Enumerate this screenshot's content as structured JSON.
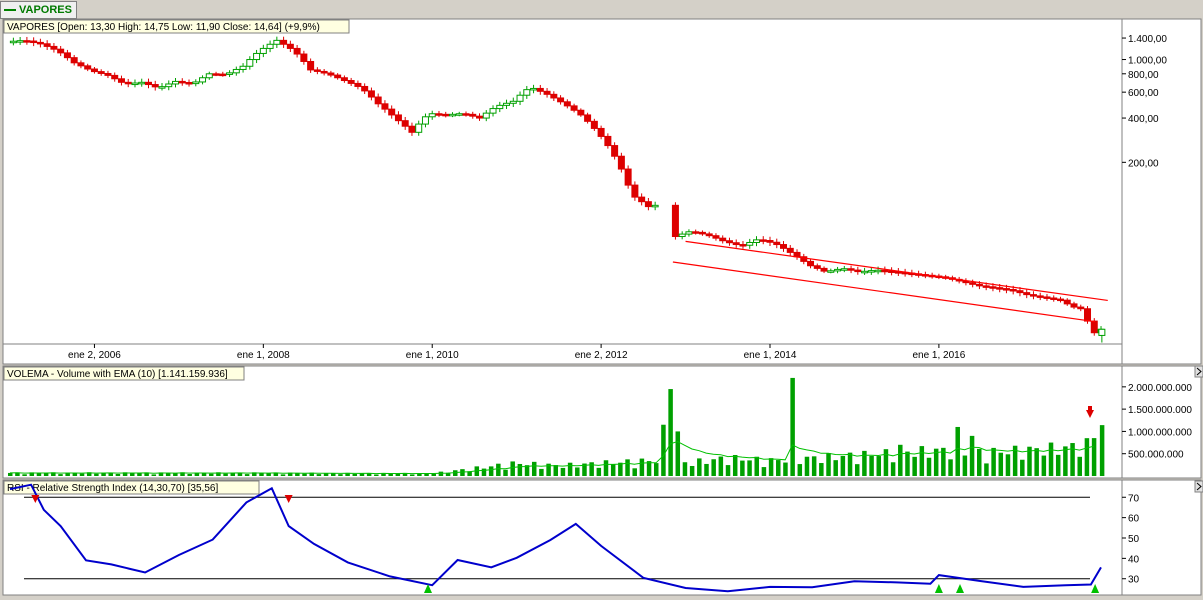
{
  "tab_label": "VAPORES",
  "panels": {
    "price": {
      "caption": "VAPORES [Open: 13,30  High: 14,75  Low: 11,90  Close: 14,64] (+9,9%)"
    },
    "volume": {
      "caption": "VOLEMA - Volume with EMA (10) [1.141.159.936]"
    },
    "rsi": {
      "caption": "RSI - Relative Strength Index (14,30,70) [35,56]"
    }
  },
  "x_axis": {
    "tick_labels": [
      "ene 2, 2006",
      "ene 1, 2008",
      "ene 1, 2010",
      "ene 2, 2012",
      "ene 1, 2014",
      "ene 1, 2016"
    ],
    "tick_years": [
      2006,
      2008,
      2010,
      2012,
      2014,
      2016
    ]
  },
  "colors": {
    "up": "#00a000",
    "down": "#dd0000",
    "ema": "#00c000",
    "rsi_line": "#0000cc",
    "channel": "#ff0000",
    "sell_marker": "#dd0000",
    "buy_marker": "#00c000"
  },
  "chart_data": [
    {
      "type": "candlestick",
      "panel": "price",
      "scale": "log",
      "ylim": [
        12,
        1800
      ],
      "y_tick_labels": [
        "1.400,00",
        "1.000,00",
        "800,00",
        "600,00",
        "400,00",
        "200,00"
      ],
      "y_tick_values": [
        1400,
        1000,
        800,
        600,
        400,
        200
      ],
      "close_anchors": [
        [
          2005.0,
          1320
        ],
        [
          2005.2,
          1350
        ],
        [
          2005.4,
          1280
        ],
        [
          2005.6,
          1150
        ],
        [
          2005.8,
          950
        ],
        [
          2006.0,
          840
        ],
        [
          2006.2,
          780
        ],
        [
          2006.4,
          680
        ],
        [
          2006.6,
          700
        ],
        [
          2006.8,
          640
        ],
        [
          2007.0,
          710
        ],
        [
          2007.2,
          680
        ],
        [
          2007.4,
          800
        ],
        [
          2007.6,
          790
        ],
        [
          2007.8,
          900
        ],
        [
          2008.0,
          1150
        ],
        [
          2008.2,
          1350
        ],
        [
          2008.4,
          1150
        ],
        [
          2008.6,
          850
        ],
        [
          2008.8,
          800
        ],
        [
          2009.0,
          720
        ],
        [
          2009.2,
          640
        ],
        [
          2009.4,
          500
        ],
        [
          2009.6,
          400
        ],
        [
          2009.8,
          320
        ],
        [
          2010.0,
          430
        ],
        [
          2010.2,
          420
        ],
        [
          2010.4,
          430
        ],
        [
          2010.6,
          400
        ],
        [
          2010.8,
          480
        ],
        [
          2011.0,
          520
        ],
        [
          2011.2,
          650
        ],
        [
          2011.4,
          580
        ],
        [
          2011.6,
          500
        ],
        [
          2011.8,
          420
        ],
        [
          2012.0,
          320
        ],
        [
          2012.2,
          220
        ],
        [
          2012.4,
          120
        ],
        [
          2012.6,
          100
        ],
        [
          2012.8,
          105
        ],
        [
          2012.9,
          62
        ],
        [
          2013.1,
          68
        ],
        [
          2013.3,
          64
        ],
        [
          2013.5,
          58
        ],
        [
          2013.7,
          54
        ],
        [
          2013.9,
          60
        ],
        [
          2014.1,
          56
        ],
        [
          2014.3,
          48
        ],
        [
          2014.5,
          40
        ],
        [
          2014.7,
          36
        ],
        [
          2014.9,
          38
        ],
        [
          2015.1,
          36
        ],
        [
          2015.3,
          37
        ],
        [
          2015.5,
          36
        ],
        [
          2015.7,
          35
        ],
        [
          2015.9,
          34
        ],
        [
          2016.1,
          33
        ],
        [
          2016.3,
          31
        ],
        [
          2016.5,
          29
        ],
        [
          2016.7,
          28
        ],
        [
          2016.9,
          27
        ],
        [
          2017.1,
          25
        ],
        [
          2017.3,
          24
        ],
        [
          2017.5,
          23
        ],
        [
          2017.6,
          21
        ],
        [
          2017.75,
          20
        ],
        [
          2017.85,
          13.3
        ],
        [
          2017.92,
          14.64
        ]
      ],
      "last_bar": {
        "open": 13.3,
        "high": 14.75,
        "low": 11.9,
        "close": 14.64,
        "change_pct": 9.9
      },
      "channel": [
        {
          "from": [
            2013.0,
            58
          ],
          "to": [
            2018.0,
            23
          ]
        },
        {
          "from": [
            2012.85,
            42
          ],
          "to": [
            2017.85,
            16.5
          ]
        }
      ]
    },
    {
      "type": "bar",
      "panel": "volume",
      "ylim": [
        0,
        2400000000
      ],
      "y_tick_labels": [
        "2.000.000.000",
        "1.500.000.000",
        "1.000.000.000",
        "500.000.000"
      ],
      "y_tick_values": [
        2000000000,
        1500000000,
        1000000000,
        500000000
      ],
      "volume_anchors": [
        [
          2005.0,
          60000000
        ],
        [
          2008.0,
          60000000
        ],
        [
          2009.0,
          50000000
        ],
        [
          2010.0,
          50000000
        ],
        [
          2010.5,
          150000000
        ],
        [
          2011.0,
          250000000
        ],
        [
          2011.5,
          200000000
        ],
        [
          2012.0,
          250000000
        ],
        [
          2012.6,
          300000000
        ],
        [
          2013.0,
          250000000
        ],
        [
          2013.5,
          350000000
        ],
        [
          2014.0,
          300000000
        ],
        [
          2014.5,
          350000000
        ],
        [
          2015.0,
          400000000
        ],
        [
          2015.5,
          450000000
        ],
        [
          2016.0,
          500000000
        ],
        [
          2016.5,
          450000000
        ],
        [
          2017.0,
          500000000
        ],
        [
          2017.5,
          550000000
        ],
        [
          2017.9,
          650000000
        ]
      ],
      "spikes": [
        [
          2012.75,
          1150000000
        ],
        [
          2012.85,
          1950000000
        ],
        [
          2012.93,
          1000000000
        ],
        [
          2014.25,
          2200000000
        ],
        [
          2015.5,
          700000000
        ],
        [
          2016.25,
          1100000000
        ],
        [
          2016.4,
          900000000
        ],
        [
          2017.3,
          750000000
        ],
        [
          2017.8,
          850000000
        ],
        [
          2017.92,
          1141159936
        ]
      ],
      "ema_period": 10,
      "last_value": 1141159936
    },
    {
      "type": "line",
      "panel": "rsi",
      "ylim": [
        23,
        77
      ],
      "y_tick_labels": [
        "70",
        "60",
        "50",
        "40",
        "30"
      ],
      "y_tick_values": [
        70,
        60,
        50,
        40,
        30
      ],
      "thresholds": [
        30,
        70
      ],
      "params": [
        14,
        30,
        70
      ],
      "last_value": 35.56,
      "series": [
        {
          "x": [
            2005.0,
            2005.25,
            2005.4,
            2005.6,
            2005.9,
            2006.2,
            2006.6,
            2007.0,
            2007.4,
            2007.8,
            2008.1,
            2008.3,
            2008.6,
            2009.0,
            2009.5,
            2010.0,
            2010.3,
            2010.7,
            2011.0,
            2011.4,
            2011.7,
            2012.0,
            2012.5,
            2013.0,
            2013.5,
            2014.0,
            2014.5,
            2015.0,
            2015.5,
            2015.9,
            2016.0,
            2016.5,
            2017.0,
            2017.5,
            2017.8,
            2017.92
          ],
          "y": [
            74,
            76,
            65,
            55,
            40,
            36,
            34,
            42,
            48,
            68,
            74,
            57,
            46,
            38,
            32,
            28,
            38,
            36,
            40,
            48,
            58,
            45,
            30,
            26,
            25,
            27,
            26,
            28,
            27,
            28,
            31,
            29,
            27,
            28,
            26,
            35.56
          ]
        }
      ],
      "signals": [
        {
          "kind": "sell",
          "x": 2005.3
        },
        {
          "kind": "sell",
          "x": 2008.3
        },
        {
          "kind": "buy",
          "x": 2009.95
        },
        {
          "kind": "buy",
          "x": 2016.0
        },
        {
          "kind": "buy",
          "x": 2016.25
        },
        {
          "kind": "buy",
          "x": 2017.85
        }
      ]
    }
  ]
}
